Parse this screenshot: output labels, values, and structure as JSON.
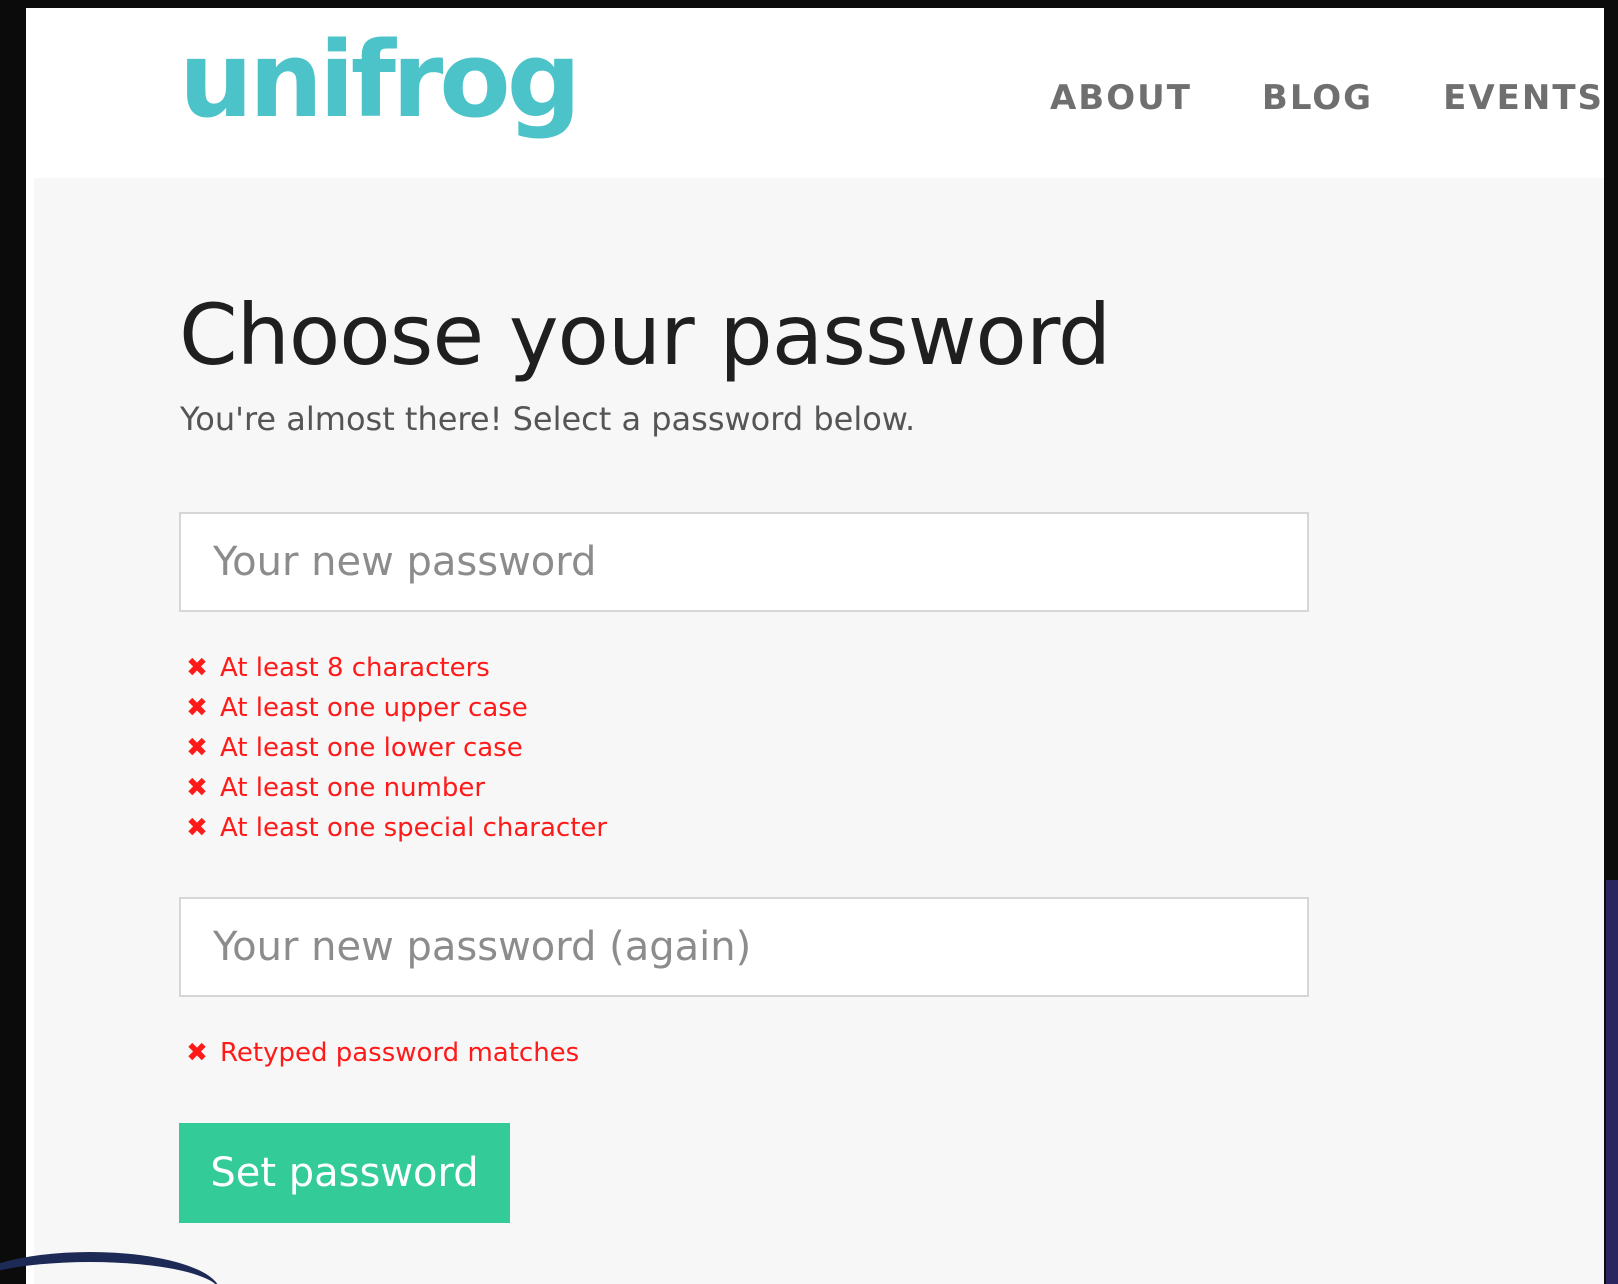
{
  "header": {
    "logo_text": "unifrog",
    "nav": [
      {
        "label": "ABOUT"
      },
      {
        "label": "BLOG"
      },
      {
        "label": "EVENTS"
      }
    ]
  },
  "main": {
    "title": "Choose your password",
    "subtitle": "You're almost there! Select a password below.",
    "password_field": {
      "placeholder": "Your new password",
      "value": ""
    },
    "password_rules": [
      {
        "label": "At least 8 characters",
        "icon": "x-icon"
      },
      {
        "label": "At least one upper case",
        "icon": "x-icon"
      },
      {
        "label": "At least one lower case",
        "icon": "x-icon"
      },
      {
        "label": "At least one number",
        "icon": "x-icon"
      },
      {
        "label": "At least one special character",
        "icon": "x-icon"
      }
    ],
    "confirm_field": {
      "placeholder": "Your new password (again)",
      "value": ""
    },
    "confirm_rules": [
      {
        "label": "Retyped password matches",
        "icon": "x-icon"
      }
    ],
    "submit_label": "Set password"
  },
  "colors": {
    "brand": "#4cc3c9",
    "error": "#ff1a1a",
    "button": "#33cc99",
    "background": "#f7f7f7"
  }
}
